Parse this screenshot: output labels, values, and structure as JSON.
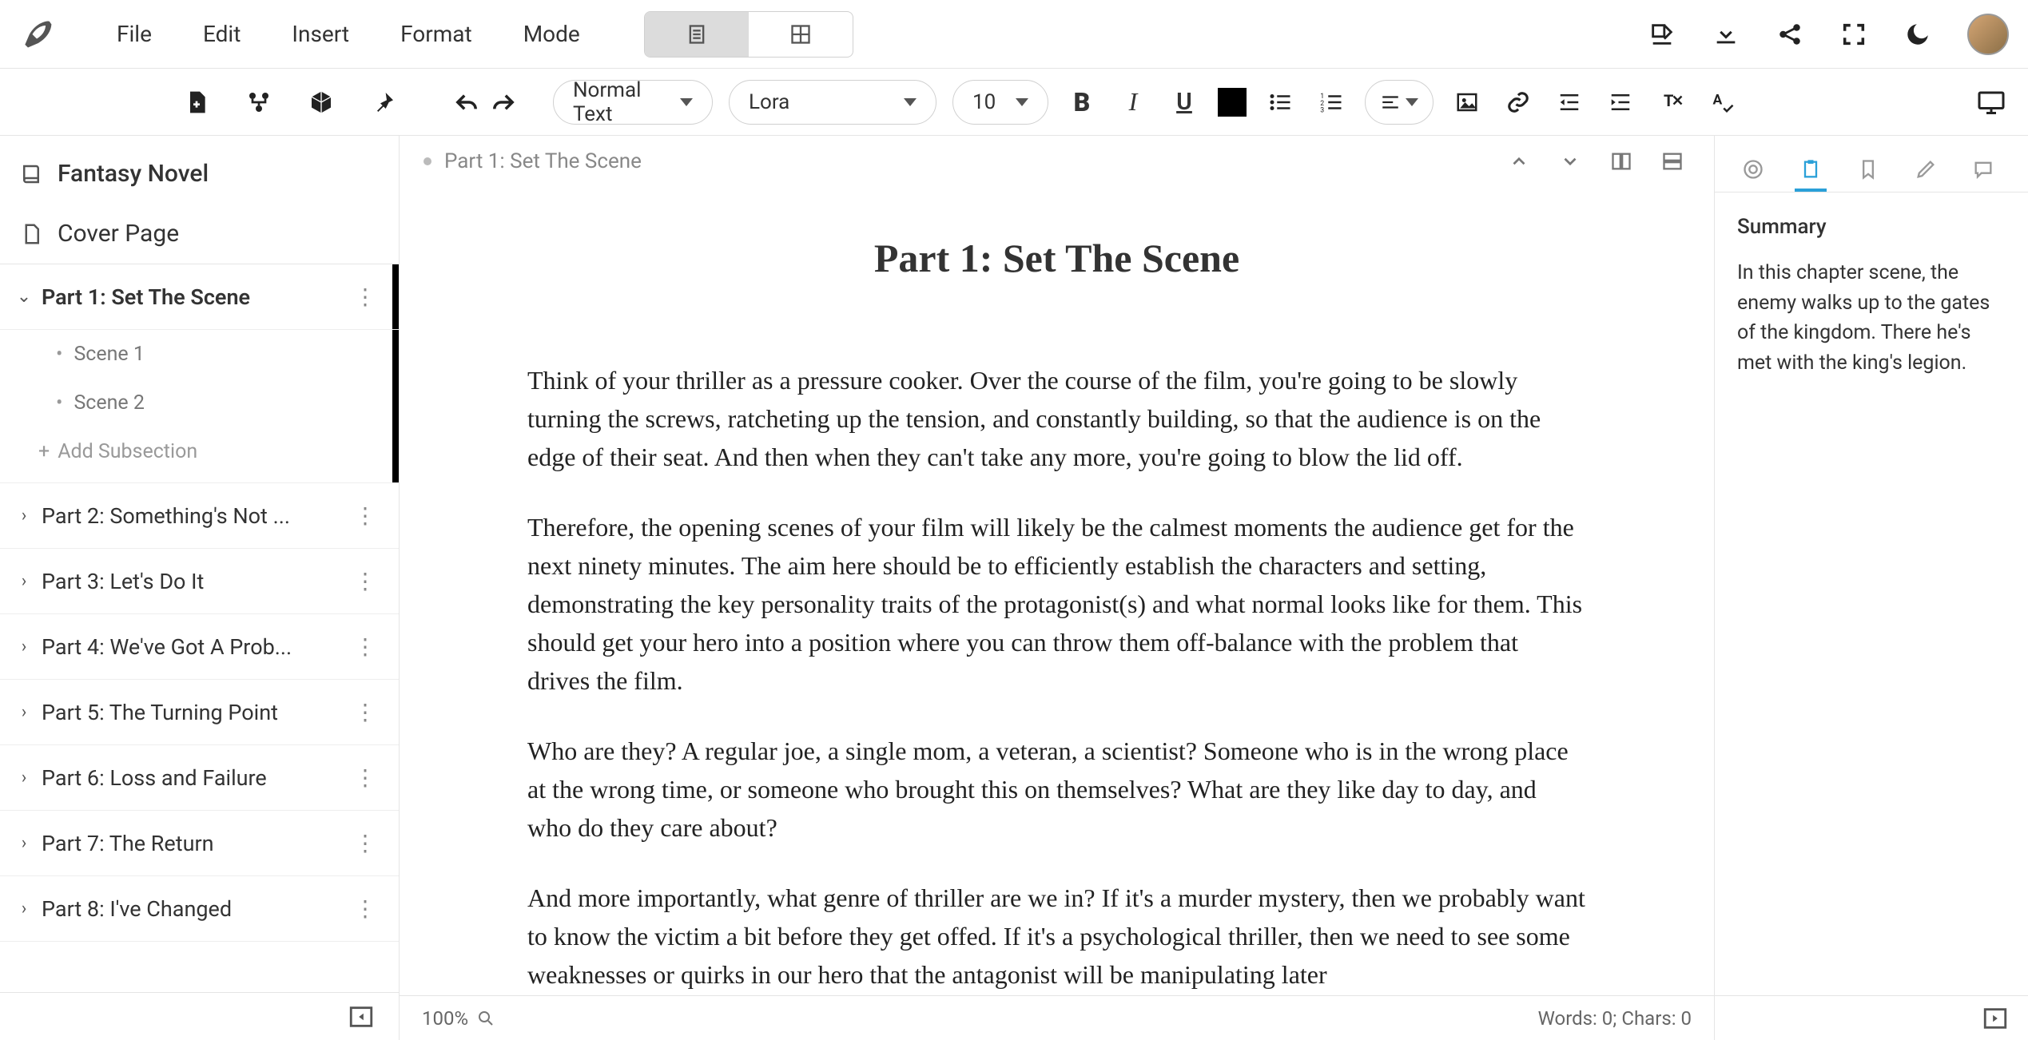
{
  "menu": {
    "file": "File",
    "edit": "Edit",
    "insert": "Insert",
    "format": "Format",
    "mode": "Mode"
  },
  "toolbar": {
    "style_select": "Normal Text",
    "font_select": "Lora",
    "size_select": "10"
  },
  "sidebar": {
    "project_title": "Fantasy Novel",
    "cover_page": "Cover Page",
    "sections": [
      {
        "label": "Part 1: Set The Scene",
        "expanded": true
      },
      {
        "label": "Part 2: Something's Not ...",
        "expanded": false
      },
      {
        "label": "Part 3: Let's Do It",
        "expanded": false
      },
      {
        "label": "Part 4: We've Got A Prob...",
        "expanded": false
      },
      {
        "label": "Part 5: The Turning Point",
        "expanded": false
      },
      {
        "label": "Part 6: Loss and Failure",
        "expanded": false
      },
      {
        "label": "Part 7: The Return",
        "expanded": false
      },
      {
        "label": "Part 8: I've Changed",
        "expanded": false
      }
    ],
    "sub_items": [
      "Scene 1",
      "Scene 2"
    ],
    "add_subsection": "Add Subsection"
  },
  "editor": {
    "breadcrumb": "Part 1: Set The Scene",
    "title": "Part 1: Set The Scene",
    "paragraphs": [
      "Think of your thriller as a pressure cooker. Over the course of the film, you're going to be slowly turning the screws, ratcheting up the tension, and constantly building, so that the audience is on the edge of their seat. And then when they can't take any more, you're going to blow the lid off.",
      "Therefore, the opening scenes of your film will likely be the calmest moments the audience get for the next ninety minutes. The aim here should be to efficiently establish the characters and setting, demonstrating the key personality traits of the protagonist(s) and what normal looks like for them. This should get your hero into a position where you can throw them off-balance with the problem that drives the film.",
      "Who are they? A regular joe, a single mom, a veteran, a scientist? Someone who is in the wrong place at the wrong time, or someone who brought this on themselves? What are they like day to day, and who do they care about?",
      "And more importantly, what genre of thriller are we in? If it's a murder mystery, then we probably want to know the victim a bit before they get offed. If it's a psychological thriller, then we need to see some weaknesses or quirks in our hero that the antagonist will be manipulating later"
    ],
    "zoom": "100%",
    "status": "Words: 0; Chars: 0"
  },
  "right_panel": {
    "heading": "Summary",
    "text": "In this chapter scene, the enemy walks up to the gates of the kingdom. There he's met with the king's legion."
  }
}
